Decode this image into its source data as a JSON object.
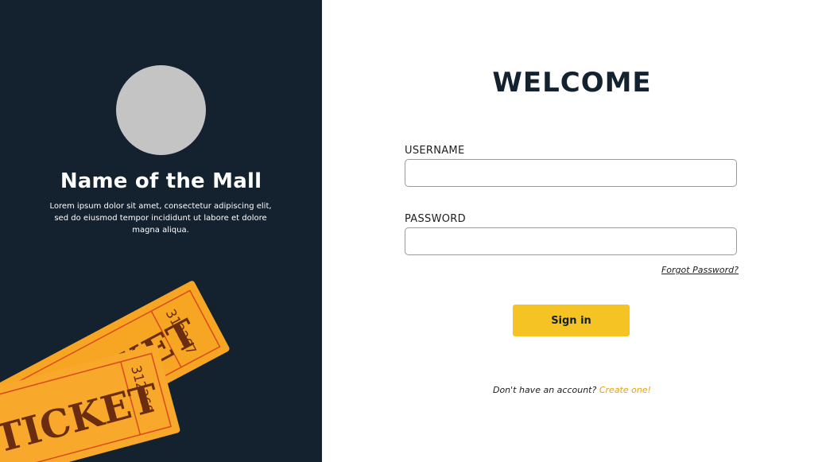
{
  "brand": {
    "mall_name": "Name of the Mall",
    "description": "Lorem ipsum dolor sit amet, consectetur adipiscing elit, sed do eiusmod tempor incididunt ut labore et dolore magna aliqua.",
    "ticket_word": "TICKET",
    "ticket_number_back": "312267",
    "ticket_number_front": "312268"
  },
  "login": {
    "title": "WELCOME",
    "username_label": "USERNAME",
    "username_value": "",
    "password_label": "PASSWORD",
    "password_value": "",
    "forgot_label": "Forgot Password?",
    "signin_label": "Sign in",
    "no_account_text": "Don't have an account?",
    "create_link": "Create one!"
  },
  "colors": {
    "panel_dark": "#14212e",
    "accent_yellow": "#f5c323",
    "ticket_orange": "#f6a623",
    "link_orange": "#e8a10f"
  }
}
